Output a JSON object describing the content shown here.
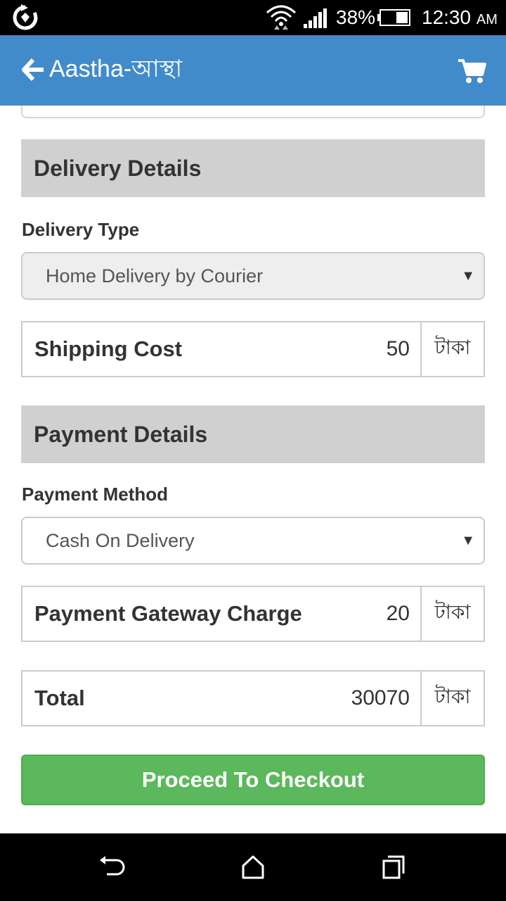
{
  "status_bar": {
    "battery_percent": "38%",
    "time": "12:30",
    "time_suffix": "AM",
    "icons": [
      "sync-icon",
      "wifi-icon",
      "cell-signal-icon",
      "battery-icon"
    ]
  },
  "app_bar": {
    "title": "Aastha-আস্থা",
    "accent_color": "#428bca",
    "icons": [
      "back-arrow-icon",
      "cart-icon"
    ]
  },
  "delivery": {
    "section_title": "Delivery Details",
    "type_label": "Delivery Type",
    "type_selected": "Home Delivery by Courier",
    "shipping_label": "Shipping Cost",
    "shipping_value": "50",
    "currency": "টাকা"
  },
  "payment": {
    "section_title": "Payment Details",
    "method_label": "Payment Method",
    "method_selected": "Cash On Delivery",
    "gateway_label": "Payment Gateway Charge",
    "gateway_value": "20",
    "currency": "টাকা"
  },
  "total": {
    "label": "Total",
    "value": "30070",
    "currency": "টাকা"
  },
  "checkout": {
    "label": "Proceed To Checkout",
    "color": "#5cb85c"
  },
  "nav_bar": {
    "icons": [
      "back-icon",
      "home-icon",
      "recents-icon"
    ]
  }
}
